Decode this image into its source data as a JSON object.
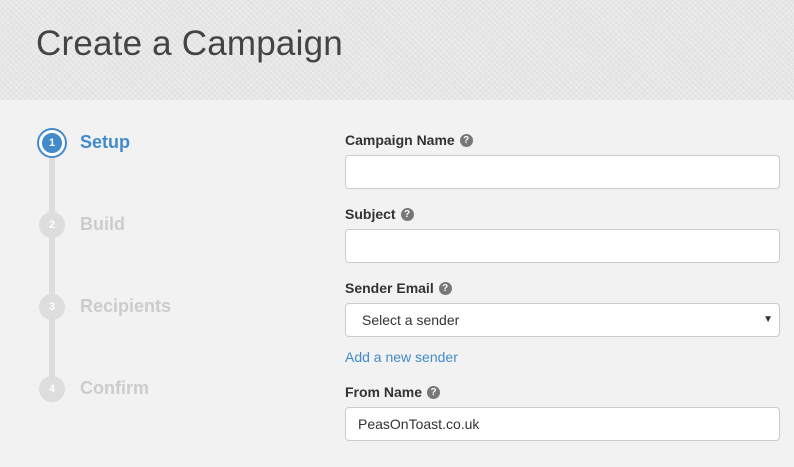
{
  "header": {
    "title": "Create a Campaign"
  },
  "steps": [
    {
      "number": "1",
      "label": "Setup",
      "active": true
    },
    {
      "number": "2",
      "label": "Build",
      "active": false
    },
    {
      "number": "3",
      "label": "Recipients",
      "active": false
    },
    {
      "number": "4",
      "label": "Confirm",
      "active": false
    }
  ],
  "form": {
    "campaign_name": {
      "label": "Campaign Name",
      "value": "",
      "help_icon": "question-circle-icon"
    },
    "subject": {
      "label": "Subject",
      "value": "",
      "help_icon": "question-circle-icon"
    },
    "sender_email": {
      "label": "Sender Email",
      "selected": "Select a sender",
      "help_icon": "question-circle-icon"
    },
    "add_sender_link": "Add a new sender",
    "from_name": {
      "label": "From Name",
      "value": "PeasOnToast.co.uk",
      "help_icon": "question-circle-icon"
    }
  },
  "colors": {
    "accent": "#428bca",
    "inactive": "#cccccc",
    "background": "#f2f2f2"
  }
}
